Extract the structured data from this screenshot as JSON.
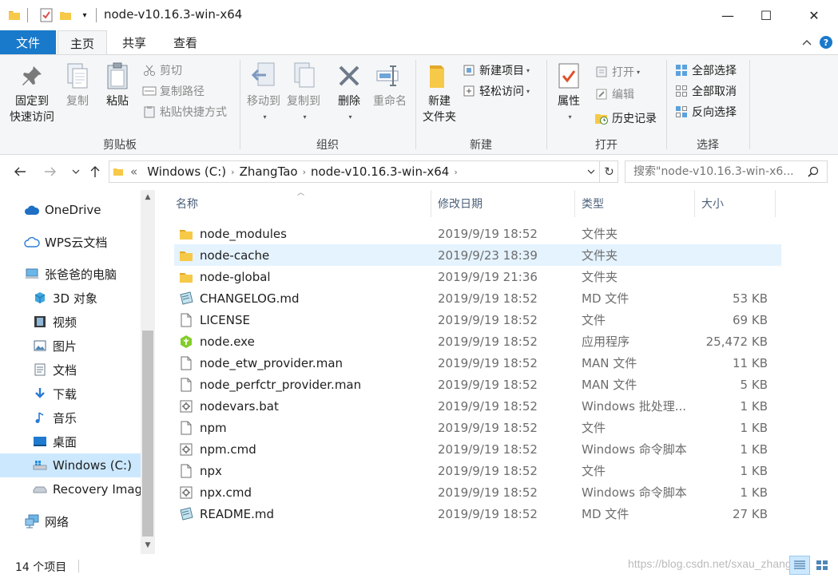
{
  "window": {
    "title": "node-v10.16.3-win-x64",
    "minimize": "—",
    "maximize": "☐",
    "close": "✕"
  },
  "ribbon_tabs": {
    "file": "文件",
    "home": "主页",
    "share": "共享",
    "view": "查看"
  },
  "ribbon": {
    "clipboard": {
      "label": "剪贴板",
      "pin_line1": "固定到",
      "pin_line2": "快速访问",
      "copy": "复制",
      "paste": "粘贴",
      "cut": "剪切",
      "copy_path": "复制路径",
      "paste_shortcut": "粘贴快捷方式"
    },
    "organize": {
      "label": "组织",
      "move_to": "移动到",
      "copy_to": "复制到",
      "delete": "删除",
      "rename": "重命名"
    },
    "new": {
      "label": "新建",
      "new_folder_line1": "新建",
      "new_folder_line2": "文件夹",
      "new_item": "新建项目",
      "easy_access": "轻松访问"
    },
    "open": {
      "label": "打开",
      "properties": "属性",
      "open": "打开",
      "edit": "编辑",
      "history": "历史记录"
    },
    "select": {
      "label": "选择",
      "select_all": "全部选择",
      "select_none": "全部取消",
      "invert": "反向选择"
    }
  },
  "address": {
    "prefix": "«",
    "crumbs": [
      "Windows (C:)",
      "ZhangTao",
      "node-v10.16.3-win-x64"
    ],
    "search_placeholder": "搜索\"node-v10.16.3-win-x6..."
  },
  "nav_pane": [
    {
      "label": "OneDrive",
      "icon": "cloud-icon"
    },
    {
      "label": "WPS云文档",
      "icon": "cloud-outline-icon"
    },
    {
      "label": "张爸爸的电脑",
      "icon": "computer-icon"
    },
    {
      "label": "3D 对象",
      "icon": "cube-icon"
    },
    {
      "label": "视频",
      "icon": "video-icon"
    },
    {
      "label": "图片",
      "icon": "picture-icon"
    },
    {
      "label": "文档",
      "icon": "document-icon"
    },
    {
      "label": "下载",
      "icon": "download-icon"
    },
    {
      "label": "音乐",
      "icon": "music-icon"
    },
    {
      "label": "桌面",
      "icon": "desktop-icon"
    },
    {
      "label": "Windows  (C:)",
      "icon": "drive-windows-icon"
    },
    {
      "label": "Recovery Imag",
      "icon": "drive-icon"
    },
    {
      "label": "网络",
      "icon": "network-icon"
    }
  ],
  "columns": {
    "name": "名称",
    "date": "修改日期",
    "type": "类型",
    "size": "大小"
  },
  "files": [
    {
      "name": "node_modules",
      "date": "2019/9/19 18:52",
      "type": "文件夹",
      "size": "",
      "icon": "folder-icon"
    },
    {
      "name": "node-cache",
      "date": "2019/9/23 18:39",
      "type": "文件夹",
      "size": "",
      "icon": "folder-icon"
    },
    {
      "name": "node-global",
      "date": "2019/9/19 21:36",
      "type": "文件夹",
      "size": "",
      "icon": "folder-icon"
    },
    {
      "name": "CHANGELOG.md",
      "date": "2019/9/19 18:52",
      "type": "MD 文件",
      "size": "53 KB",
      "icon": "md-file-icon"
    },
    {
      "name": "LICENSE",
      "date": "2019/9/19 18:52",
      "type": "文件",
      "size": "69 KB",
      "icon": "file-icon"
    },
    {
      "name": "node.exe",
      "date": "2019/9/19 18:52",
      "type": "应用程序",
      "size": "25,472 KB",
      "icon": "node-exe-icon"
    },
    {
      "name": "node_etw_provider.man",
      "date": "2019/9/19 18:52",
      "type": "MAN 文件",
      "size": "11 KB",
      "icon": "file-icon"
    },
    {
      "name": "node_perfctr_provider.man",
      "date": "2019/9/19 18:52",
      "type": "MAN 文件",
      "size": "5 KB",
      "icon": "file-icon"
    },
    {
      "name": "nodevars.bat",
      "date": "2019/9/19 18:52",
      "type": "Windows 批处理...",
      "size": "1 KB",
      "icon": "script-file-icon"
    },
    {
      "name": "npm",
      "date": "2019/9/19 18:52",
      "type": "文件",
      "size": "1 KB",
      "icon": "file-icon"
    },
    {
      "name": "npm.cmd",
      "date": "2019/9/19 18:52",
      "type": "Windows 命令脚本",
      "size": "1 KB",
      "icon": "script-file-icon"
    },
    {
      "name": "npx",
      "date": "2019/9/19 18:52",
      "type": "文件",
      "size": "1 KB",
      "icon": "file-icon"
    },
    {
      "name": "npx.cmd",
      "date": "2019/9/19 18:52",
      "type": "Windows 命令脚本",
      "size": "1 KB",
      "icon": "script-file-icon"
    },
    {
      "name": "README.md",
      "date": "2019/9/19 18:52",
      "type": "MD 文件",
      "size": "27 KB",
      "icon": "md-file-icon"
    }
  ],
  "status": {
    "count": "14 个项目",
    "watermark": "https://blog.csdn.net/sxau_zhangtao"
  },
  "colors": {
    "accent": "#1979ca",
    "selection": "#cce8ff",
    "hover": "#e5f3ff",
    "folder": "#f7c948"
  }
}
